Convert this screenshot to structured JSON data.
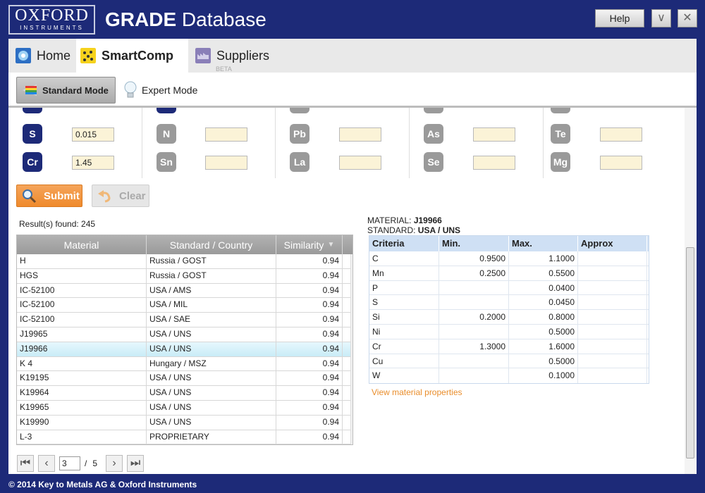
{
  "window": {
    "logo_line1": "OXFORD",
    "logo_line2": "INSTRUMENTS",
    "title_bold": "GRADE",
    "title_rest": " Database",
    "help_label": "Help",
    "minimize_glyph": "∨",
    "close_glyph": "✕"
  },
  "nav": {
    "tabs": [
      {
        "label": "Home"
      },
      {
        "label": "SmartComp"
      },
      {
        "label": "Suppliers"
      }
    ],
    "beta_label": "BETA"
  },
  "modes": {
    "standard_label": "Standard Mode",
    "expert_label": "Expert Mode"
  },
  "elements": {
    "row1": [
      {
        "symbol": "S",
        "value": "0.015"
      },
      {
        "symbol": "N",
        "value": ""
      },
      {
        "symbol": "Pb",
        "value": ""
      },
      {
        "symbol": "As",
        "value": ""
      },
      {
        "symbol": "Te",
        "value": ""
      }
    ],
    "row2": [
      {
        "symbol": "Cr",
        "value": "1.45"
      },
      {
        "symbol": "Sn",
        "value": ""
      },
      {
        "symbol": "La",
        "value": ""
      },
      {
        "symbol": "Se",
        "value": ""
      },
      {
        "symbol": "Mg",
        "value": ""
      }
    ]
  },
  "actions": {
    "submit_label": "Submit",
    "clear_label": "Clear"
  },
  "results": {
    "found_text": "Result(s) found: 245",
    "columns": [
      "Material",
      "Standard / Country",
      "Similarity"
    ],
    "rows": [
      {
        "material": "H",
        "standard": "Russia / GOST",
        "similarity": "0.94"
      },
      {
        "material": "HGS",
        "standard": "Russia / GOST",
        "similarity": "0.94"
      },
      {
        "material": "IC-52100",
        "standard": "USA / AMS",
        "similarity": "0.94"
      },
      {
        "material": "IC-52100",
        "standard": "USA / MIL",
        "similarity": "0.94"
      },
      {
        "material": "IC-52100",
        "standard": "USA / SAE",
        "similarity": "0.94"
      },
      {
        "material": "J19965",
        "standard": "USA / UNS",
        "similarity": "0.94"
      },
      {
        "material": "J19966",
        "standard": "USA / UNS",
        "similarity": "0.94"
      },
      {
        "material": "K 4",
        "standard": "Hungary / MSZ",
        "similarity": "0.94"
      },
      {
        "material": "K19195",
        "standard": "USA / UNS",
        "similarity": "0.94"
      },
      {
        "material": "K19964",
        "standard": "USA / UNS",
        "similarity": "0.94"
      },
      {
        "material": "K19965",
        "standard": "USA / UNS",
        "similarity": "0.94"
      },
      {
        "material": "K19990",
        "standard": "USA / UNS",
        "similarity": "0.94"
      },
      {
        "material": "L-3",
        "standard": "PROPRIETARY",
        "similarity": "0.94"
      }
    ],
    "selected_row": 6
  },
  "pager": {
    "current_page": "3",
    "separator": "/",
    "total_pages": "5"
  },
  "detail": {
    "material_label": "MATERIAL:",
    "material_value": "J19966",
    "standard_label": "STANDARD:",
    "standard_value": "USA / UNS",
    "columns": [
      "Criteria",
      "Min.",
      "Max.",
      "Approx"
    ],
    "rows": [
      {
        "criteria": "C",
        "min": "0.9500",
        "max": "1.1000",
        "approx": ""
      },
      {
        "criteria": "Mn",
        "min": "0.2500",
        "max": "0.5500",
        "approx": ""
      },
      {
        "criteria": "P",
        "min": "",
        "max": "0.0400",
        "approx": ""
      },
      {
        "criteria": "S",
        "min": "",
        "max": "0.0450",
        "approx": ""
      },
      {
        "criteria": "Si",
        "min": "0.2000",
        "max": "0.8000",
        "approx": ""
      },
      {
        "criteria": "Ni",
        "min": "",
        "max": "0.5000",
        "approx": ""
      },
      {
        "criteria": "Cr",
        "min": "1.3000",
        "max": "1.6000",
        "approx": ""
      },
      {
        "criteria": "Cu",
        "min": "",
        "max": "0.5000",
        "approx": ""
      },
      {
        "criteria": "W",
        "min": "",
        "max": "0.1000",
        "approx": ""
      }
    ],
    "link_label": "View material properties"
  },
  "footer": {
    "copyright": "© 2014 Key to Metals AG & Oxford Instruments"
  },
  "colors": {
    "brand_navy": "#1d2a78",
    "accent_orange": "#ef8a2c",
    "input_bg": "#fbf3d7"
  }
}
